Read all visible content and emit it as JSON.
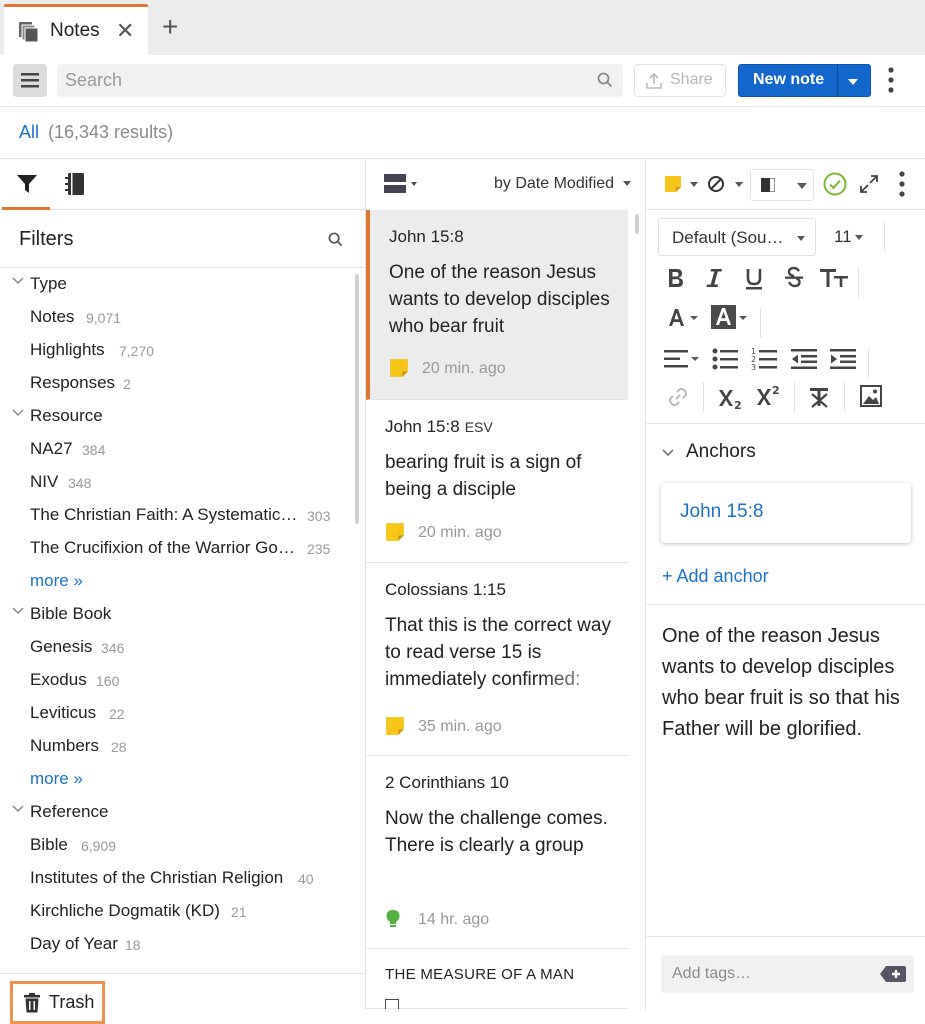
{
  "tab": {
    "title": "Notes",
    "close": "✕",
    "new": "+"
  },
  "toolbar": {
    "search_placeholder": "Search",
    "share_label": "Share",
    "new_note_label": "New note"
  },
  "results": {
    "scope": "All",
    "count": "(16,343 results)"
  },
  "filters": {
    "title": "Filters",
    "groups": [
      {
        "label": "Type",
        "items": [
          {
            "label": "Notes",
            "count": "9,071"
          },
          {
            "label": "Highlights",
            "count": "7,270"
          },
          {
            "label": "Responses",
            "count": "2"
          }
        ]
      },
      {
        "label": "Resource",
        "items": [
          {
            "label": "NA27",
            "count": "384"
          },
          {
            "label": "NIV",
            "count": "348"
          },
          {
            "label": "The Christian Faith: A Systematic…",
            "count": "303"
          },
          {
            "label": "The Crucifixion of the Warrior Go…",
            "count": "235"
          }
        ],
        "more": "more »"
      },
      {
        "label": "Bible Book",
        "items": [
          {
            "label": "Genesis",
            "count": "346"
          },
          {
            "label": "Exodus",
            "count": "160"
          },
          {
            "label": "Leviticus",
            "count": "22"
          },
          {
            "label": "Numbers",
            "count": "28"
          }
        ],
        "more": "more »"
      },
      {
        "label": "Reference",
        "items": [
          {
            "label": "Bible",
            "count": "6,909"
          },
          {
            "label": "Institutes of the Christian Religion",
            "count": "40"
          },
          {
            "label": "Kirchliche Dogmatik (KD)",
            "count": "21"
          },
          {
            "label": "Day of Year",
            "count": "18"
          }
        ]
      }
    ],
    "trash": "Trash"
  },
  "list": {
    "sort": "by Date Modified",
    "notes": [
      {
        "title": "John 15:8",
        "title_suffix": "",
        "body": "One of the reason Jesus wants to develop disciples who bear fruit",
        "time": "20 min. ago",
        "icon": "sticky-note-icon"
      },
      {
        "title": "John 15:8",
        "title_suffix": "ESV",
        "body": "bearing fruit is a sign of being a disciple",
        "time": "20 min. ago",
        "icon": "sticky-note-icon"
      },
      {
        "title": "Colossians 1:15",
        "title_suffix": "",
        "body": "That this is the correct way to read verse 15 is immediately confirmed:",
        "time": "35 min. ago",
        "icon": "sticky-note-icon"
      },
      {
        "title": "2 Corinthians 10",
        "title_suffix": "",
        "body": "Now the challenge comes.\nThere is clearly a group",
        "time": "14 hr. ago",
        "icon": "lightbulb-icon"
      },
      {
        "title": "THE MEASURE OF A MAN",
        "title_suffix": "",
        "body": "",
        "time": "",
        "icon": ""
      }
    ]
  },
  "editor": {
    "font": "Default (Sou…",
    "size": "11",
    "anchors_title": "Anchors",
    "anchor": "John 15:8",
    "add_anchor": "+ Add anchor",
    "text": "One of the reason Jesus wants to develop disciples who bear fruit is so that his Father will be glorified.",
    "tags_placeholder": "Add tags…"
  },
  "colors": {
    "accent_orange": "#e0752d",
    "link_blue": "#1a73c9",
    "primary_button": "#1266cc",
    "sticky_yellow": "#f5c518",
    "check_green": "#7cb82f"
  }
}
